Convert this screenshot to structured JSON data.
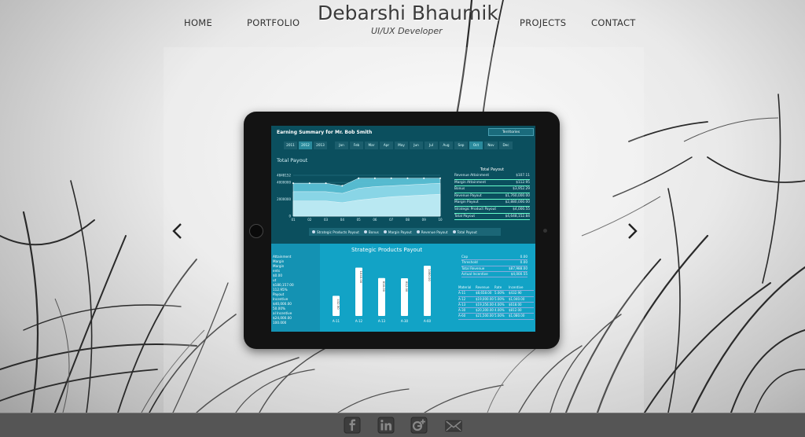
{
  "header": {
    "title": "Debarshi Bhaumik",
    "subtitle": "UI/UX Developer",
    "nav": [
      "HOME",
      "PORTFOLIO",
      "PROJECTS",
      "CONTACT"
    ]
  },
  "dashboard": {
    "title": "Earning Summary for Mr. Bob Smith",
    "territories_label": "Territories",
    "years": [
      "2011",
      "2012",
      "2013"
    ],
    "months": [
      "Jan",
      "Feb",
      "Mar",
      "Apr",
      "May",
      "Jun",
      "Jul",
      "Aug",
      "Sep",
      "Oct",
      "Nov",
      "Dec"
    ],
    "total_payout_label": "Total Payout",
    "stats_top_header": "Total Payout",
    "stats_top": [
      {
        "label": "Revenue Attainment",
        "value": "$107.11"
      },
      {
        "label": "Margin Attainment",
        "value": "$112.95"
      },
      {
        "label": "Bonus",
        "value": "$3,952.29"
      },
      {
        "label": "Revenue Payout",
        "value": "$1,760,000.00"
      },
      {
        "label": "Margin Payout",
        "value": "$2,880,000.00"
      },
      {
        "label": "Strategic Product Payout",
        "value": "$4,000.55"
      },
      {
        "label": "Total Payout",
        "value": "$4,648,152.84"
      }
    ],
    "legend": [
      "Strategic Products Payout",
      "Bonus",
      "Margin Payout",
      "Revenue Payout",
      "Total Payout"
    ],
    "strategic_title": "Strategic Products Payout",
    "left_panel": [
      "Attainment",
      "Margin",
      "Margin",
      "ents",
      "$0.00",
      "ut",
      "$180,157.00",
      "112.95%",
      "Payout",
      "Incentive",
      "$40,000.00",
      "50.00%",
      "al Incentive",
      "$24,000.00",
      "100.000"
    ],
    "stats_right1": [
      {
        "label": "Cap",
        "value": "0.00"
      },
      {
        "label": "Threshold",
        "value": "0.00"
      },
      {
        "label": "Total Revenue",
        "value": "$87,988.00"
      },
      {
        "label": "Actual Incentive",
        "value": "$4,000.55"
      }
    ],
    "stats_right2_header": [
      "Material",
      "Revenue",
      "Rate",
      "Incentive"
    ],
    "stats_right2": [
      [
        "A-11",
        "$8,658.00",
        "5.00%",
        "$432.90"
      ],
      [
        "A-12",
        "$19,000.00",
        "5.00%",
        "$1,040.00"
      ],
      [
        "A-13",
        "$19,356.00",
        "4.00%",
        "$618.00"
      ],
      [
        "A-30",
        "$20,300.00",
        "4.00%",
        "$812.00"
      ],
      [
        "A-60",
        "$21,500.00",
        "5.00%",
        "$1,080.00"
      ]
    ]
  },
  "footer": {
    "icons": [
      "facebook-icon",
      "linkedin-icon",
      "google-plus-icon",
      "email-icon"
    ]
  },
  "chart_data": [
    {
      "type": "area",
      "title": "Total Payout",
      "x": [
        "01",
        "02",
        "03",
        "04",
        "05",
        "06",
        "07",
        "08",
        "09",
        "10"
      ],
      "ytick_labels": [
        "0",
        "2000000",
        "4000000",
        "4848152"
      ],
      "ylim": [
        0,
        4848152
      ],
      "series": [
        {
          "name": "Total Payout",
          "values": [
            3900000,
            3900000,
            3900000,
            3600000,
            4500000,
            4500000,
            4500000,
            4500000,
            4500000,
            4500000
          ]
        },
        {
          "name": "Margin Payout",
          "values": [
            2900000,
            2900000,
            2900000,
            2700000,
            3300000,
            3500000,
            3600000,
            3700000,
            3800000,
            3900000
          ]
        },
        {
          "name": "Revenue Payout",
          "values": [
            1800000,
            1800000,
            1800000,
            1600000,
            1900000,
            2100000,
            2300000,
            2400000,
            2500000,
            2600000
          ]
        }
      ],
      "grid": true
    },
    {
      "type": "bar",
      "title": "Strategic Products Payout",
      "categories": [
        "A-11",
        "A-12",
        "A-13",
        "A-30",
        "A-60"
      ],
      "values": [
        432.9,
        1040,
        816,
        812,
        1080
      ],
      "data_labels": [
        "432.90",
        "1040.00",
        "816.00",
        "812.00",
        "1080.00"
      ],
      "ylim": [
        0,
        1150
      ]
    }
  ]
}
